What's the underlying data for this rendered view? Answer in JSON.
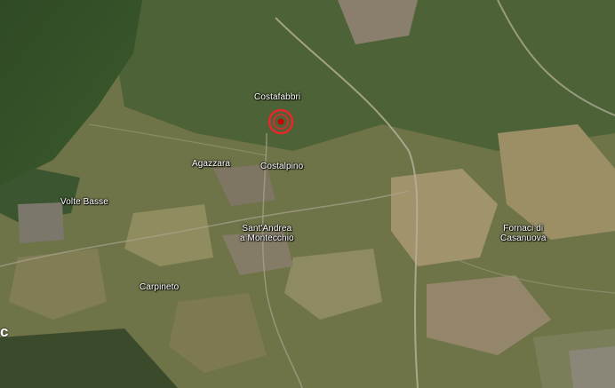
{
  "map": {
    "type": "satellite",
    "places": [
      {
        "id": "costafabbri",
        "name": "Costafabbri"
      },
      {
        "id": "agazzara",
        "name": "Agazzara"
      },
      {
        "id": "costalpino",
        "name": "Costalpino"
      },
      {
        "id": "volte-basse",
        "name": "Volte Basse"
      },
      {
        "id": "sant-andrea",
        "name": "Sant'Andrea\na Montecchio"
      },
      {
        "id": "fornaci",
        "name": "Fornaci di\nCasanuova"
      },
      {
        "id": "carpineto",
        "name": "Carpineto"
      }
    ],
    "marker": {
      "icon": "location-pin-icon",
      "color": "#e8272a"
    },
    "edge_glyph": "c"
  }
}
